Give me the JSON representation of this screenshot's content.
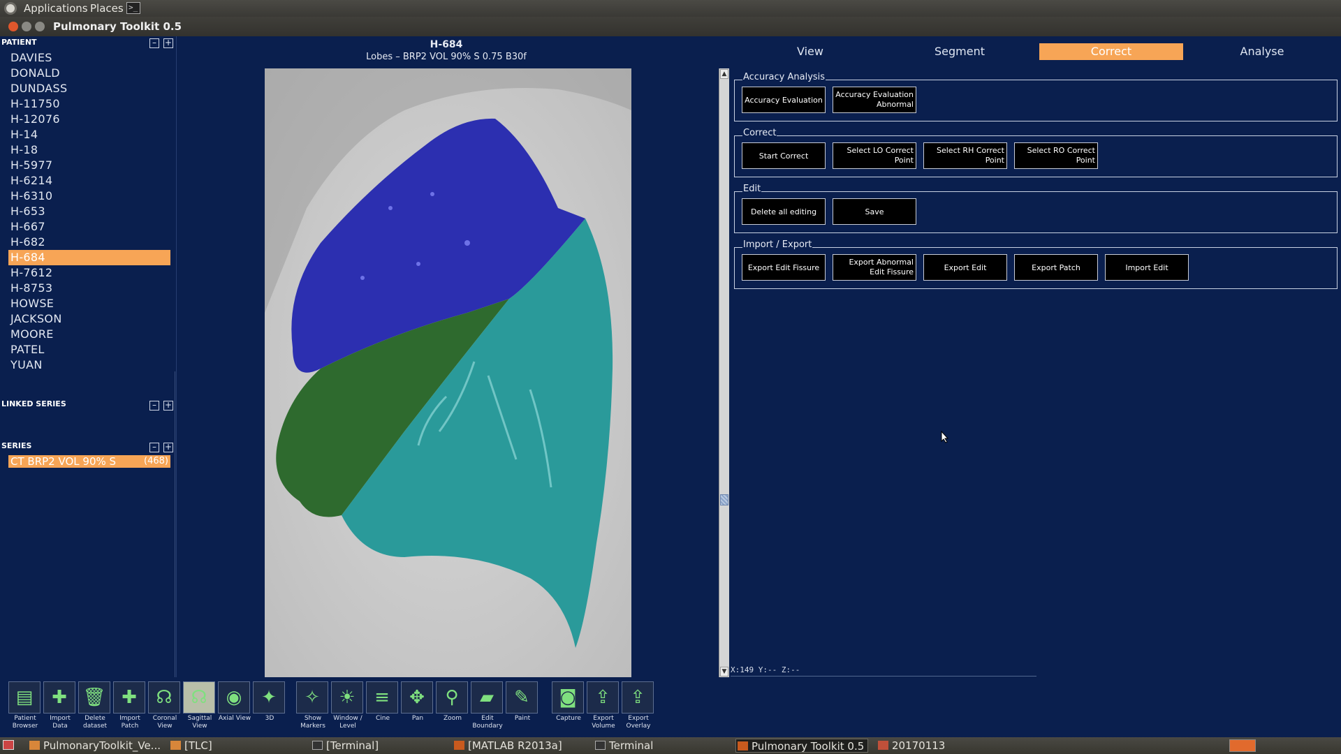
{
  "top_panel": {
    "applications": "Applications",
    "places": "Places"
  },
  "window": {
    "title": "Pulmonary Toolkit 0.5"
  },
  "left": {
    "patient_head": "PATIENT",
    "patients": [
      "DAVIES",
      "DONALD",
      "DUNDASS",
      "H-11750",
      "H-12076",
      "H-14",
      "H-18",
      "H-5977",
      "H-6214",
      "H-6310",
      "H-653",
      "H-667",
      "H-682",
      "H-684",
      "H-7612",
      "H-8753",
      "HOWSE",
      "JACKSON",
      "MOORE",
      "PATEL",
      "YUAN"
    ],
    "selected_patient": "H-684",
    "linked_head": "LINKED SERIES",
    "series_head": "SERIES",
    "series_item": {
      "label": "CT   BRP2 VOL 90% S",
      "count": "(468)"
    },
    "collapse_symbol": "–",
    "expand_symbol": "+"
  },
  "image": {
    "title": "H-684",
    "subtitle": "Lobes – BRP2 VOL 90% S  0.75  B30f",
    "coords": "X:149 Y:-- Z:--"
  },
  "tabs": [
    "View",
    "Segment",
    "Correct",
    "Analyse"
  ],
  "active_tab": "Correct",
  "groups": {
    "accuracy": {
      "label": "Accuracy Analysis",
      "buttons": [
        "Accuracy Evaluation",
        "Accuracy Evaluation Abnormal"
      ]
    },
    "correct": {
      "label": "Correct",
      "buttons": [
        "Start Correct",
        "Select LO Correct Point",
        "Select RH Correct Point",
        "Select RO Correct Point"
      ]
    },
    "edit": {
      "label": "Edit",
      "buttons": [
        "Delete all editing",
        "Save"
      ]
    },
    "import_export": {
      "label": "Import / Export",
      "buttons": [
        "Export Edit Fissure",
        "Export Abnormal Edit Fissure",
        "Export Edit",
        "Export Patch",
        "Import Edit"
      ]
    }
  },
  "toolbar": [
    {
      "label": "Patient\nBrowser",
      "icon": "patient-browser-icon"
    },
    {
      "label": "Import\nData",
      "icon": "plus-icon"
    },
    {
      "label": "Delete\ndataset",
      "icon": "trash-icon"
    },
    {
      "label": "Import\nPatch",
      "icon": "import-patch-icon"
    },
    {
      "label": "Coronal\nView",
      "icon": "coronal-view-icon"
    },
    {
      "label": "Sagittal\nView",
      "icon": "sagittal-view-icon"
    },
    {
      "label": "Axial View",
      "icon": "axial-view-icon"
    },
    {
      "label": "3D",
      "icon": "3d-view-icon"
    },
    {
      "label": "Show\nMarkers",
      "icon": "markers-icon"
    },
    {
      "label": "Window /\nLevel",
      "icon": "window-level-icon"
    },
    {
      "label": "Cine",
      "icon": "cine-icon"
    },
    {
      "label": "Pan",
      "icon": "pan-icon"
    },
    {
      "label": "Zoom",
      "icon": "zoom-icon"
    },
    {
      "label": "Edit\nBoundary",
      "icon": "edit-boundary-icon"
    },
    {
      "label": "Paint",
      "icon": "paint-icon"
    },
    {
      "label": "Capture",
      "icon": "camera-icon"
    },
    {
      "label": "Export\nVolume",
      "icon": "export-volume-icon"
    },
    {
      "label": "Export\nOverlay",
      "icon": "export-overlay-icon"
    }
  ],
  "taskbar": [
    "PulmonaryToolkit_Ve...",
    "[TLC]",
    "[Terminal]",
    "[MATLAB R2013a]",
    "Terminal",
    "Pulmonary Toolkit 0.5",
    "20170113"
  ],
  "colors": {
    "accent": "#f7a556",
    "background": "#0a1f4e",
    "lobe_upper": "#2c2fb0",
    "lobe_middle": "#2e6a2e",
    "lobe_lower": "#2a9a9a"
  }
}
